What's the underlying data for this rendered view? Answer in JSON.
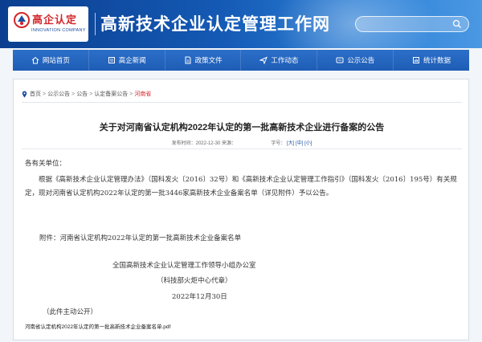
{
  "header": {
    "logo_cn": "高企认定",
    "logo_en": "INNOVATION COMPANY",
    "site_title": "高新技术企业认定管理工作网",
    "search_placeholder": ""
  },
  "nav": {
    "items": [
      {
        "label": "网站首页",
        "icon": "home-icon"
      },
      {
        "label": "高企新闻",
        "icon": "news-icon"
      },
      {
        "label": "政策文件",
        "icon": "document-icon"
      },
      {
        "label": "工作动态",
        "icon": "send-icon"
      },
      {
        "label": "公示公告",
        "icon": "notice-icon"
      },
      {
        "label": "统计数据",
        "icon": "chart-icon"
      }
    ]
  },
  "breadcrumb": {
    "items": [
      "首页",
      "公示公告",
      "公告",
      "认定备案公告"
    ],
    "current": "河南省",
    "separator": ">"
  },
  "article": {
    "title": "关于对河南省认定机构2022年认定的第一批高新技术企业进行备案的公告",
    "publish_label": "发布时间：",
    "publish_date": "2022-12-30",
    "source_label": "来源：",
    "font_size_label": "字号：",
    "font_sizes": [
      "[大]",
      "[中]",
      "[小]"
    ],
    "salutation": "各有关单位：",
    "paragraph": "根据《高新技术企业认定管理办法》（国科发火〔2016〕32号）和《高新技术企业认定管理工作指引》（国科发火〔2016〕195号）有关规定，现对河南省认定机构2022年认定的第一批3446家高新技术企业备案名单（详见附件）予以公告。",
    "attachment_note": "附件：河南省认定机构2022年认定的第一批高新技术企业备案名单",
    "signature_org": "全国高新技术企业认定管理工作领导小组办公室",
    "signature_proxy": "（科技部火炬中心代章）",
    "signature_date": "2022年12月30日",
    "public_note": "（此件主动公开）",
    "attachment_file": "河南省认定机构2022年认定的第一批高新技术企业备案名单.pdf"
  },
  "colors": {
    "header_dark": "#0b3e8f",
    "header_light": "#4b98e3",
    "nav_bg": "#1e5db5",
    "accent_red": "#d4262a",
    "link_blue": "#1a4fa0"
  }
}
